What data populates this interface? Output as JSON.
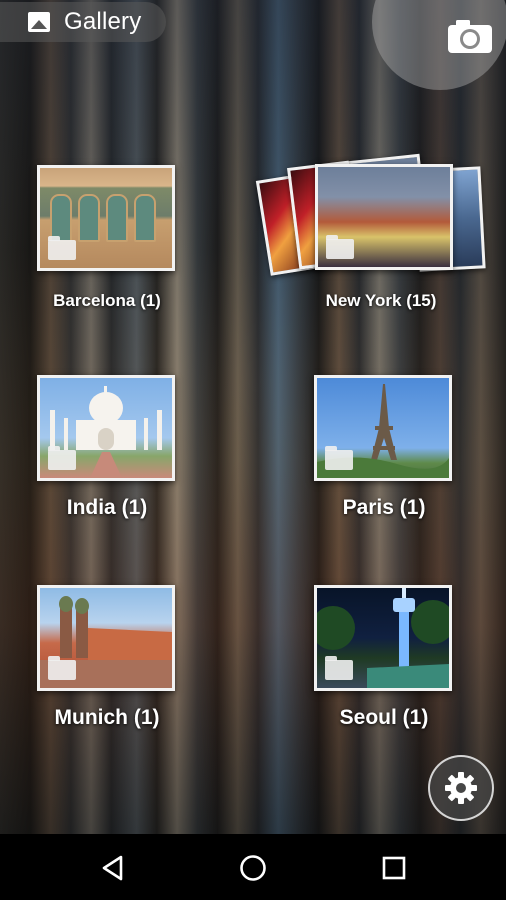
{
  "app": {
    "title": "Gallery",
    "icon": "gallery-image-icon"
  },
  "camera_button": {
    "icon": "camera-icon"
  },
  "albums": [
    {
      "name": "Barcelona",
      "count": "(1)",
      "label": "Barcelona  (1)",
      "scene": "barcelona"
    },
    {
      "name": "New York",
      "count": "(15)",
      "label": "New York  (15)",
      "scene": "new-york"
    },
    {
      "name": "India",
      "count": "(1)",
      "label": "India  (1)",
      "scene": "india"
    },
    {
      "name": "Paris",
      "count": "(1)",
      "label": "Paris  (1)",
      "scene": "paris"
    },
    {
      "name": "Munich",
      "count": "(1)",
      "label": "Munich  (1)",
      "scene": "munich"
    },
    {
      "name": "Seoul",
      "count": "(1)",
      "label": "Seoul  (1)",
      "scene": "seoul"
    }
  ],
  "settings_button": {
    "icon": "gear-icon"
  },
  "nav_bar": {
    "back_icon": "back-triangle-icon",
    "home_icon": "home-circle-icon",
    "recents_icon": "recents-square-icon"
  },
  "colors": {
    "nav_background": "#000000",
    "label_text": "#ffffff",
    "thumb_border": "#f2f2f2"
  }
}
